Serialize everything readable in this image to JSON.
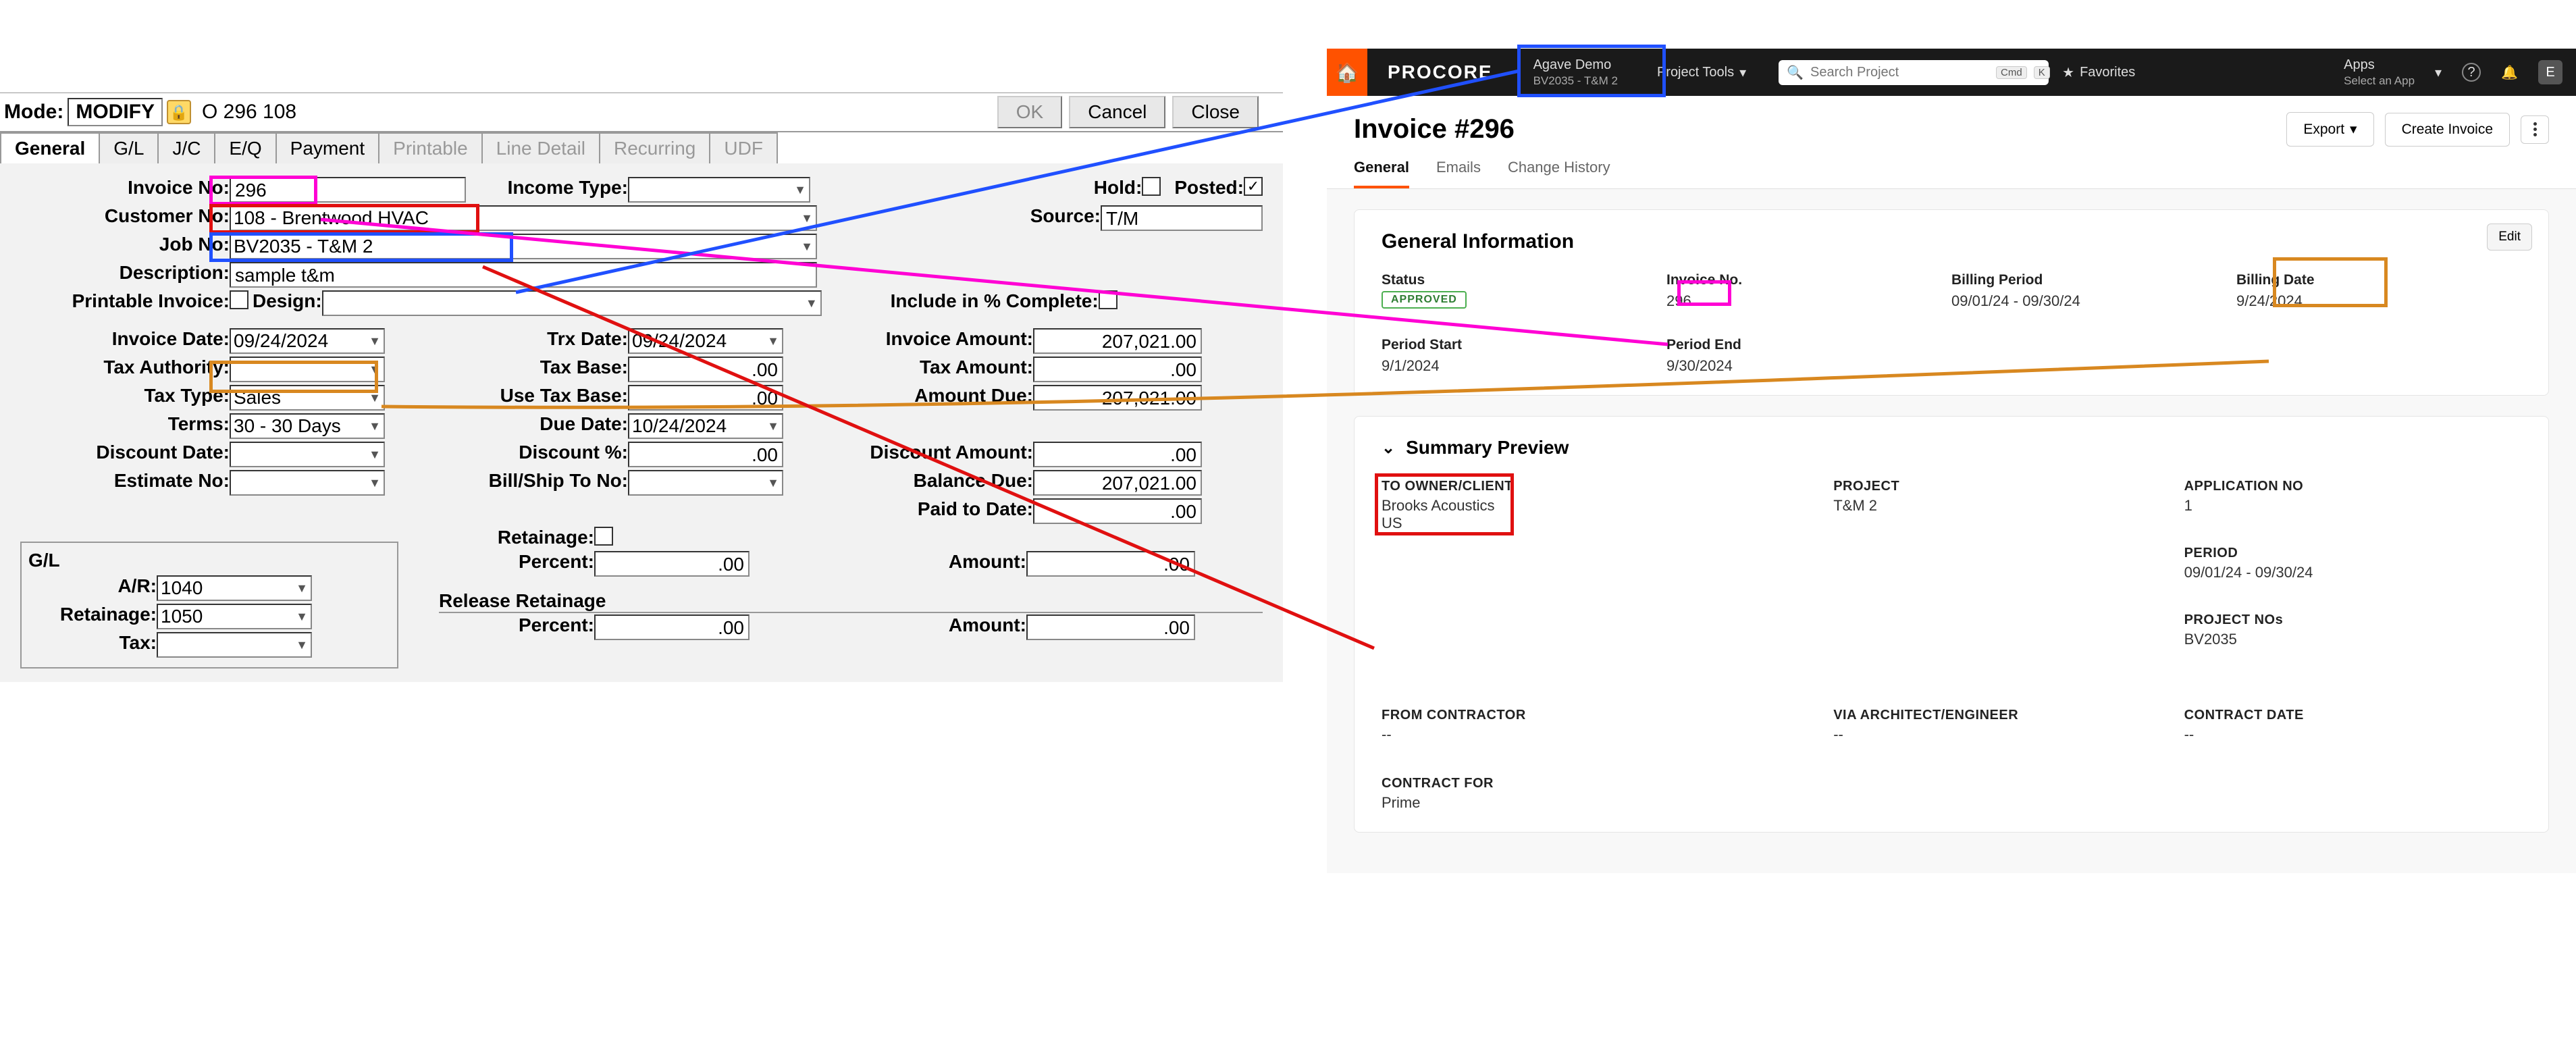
{
  "left": {
    "mode_label": "Mode:",
    "mode_value": "MODIFY",
    "lock_glyph": "🔒",
    "mode_info": "O  296  108",
    "btn_ok": "OK",
    "btn_cancel": "Cancel",
    "btn_close": "Close",
    "tabs": {
      "general": "General",
      "gl": "G/L",
      "jc": "J/C",
      "eq": "E/Q",
      "payment": "Payment",
      "printable": "Printable",
      "line_detail": "Line Detail",
      "recurring": "Recurring",
      "udf": "UDF"
    },
    "labels": {
      "invoice_no": "Invoice No:",
      "income_type": "Income Type:",
      "hold": "Hold:",
      "posted": "Posted:",
      "customer_no": "Customer No:",
      "source": "Source:",
      "job_no": "Job No:",
      "description": "Description:",
      "printable_invoice": "Printable Invoice:",
      "design": "Design:",
      "include_pct": "Include in % Complete:",
      "invoice_date": "Invoice Date:",
      "trx_date": "Trx Date:",
      "invoice_amount": "Invoice Amount:",
      "tax_authority": "Tax Authority:",
      "tax_base": "Tax Base:",
      "tax_amount": "Tax Amount:",
      "tax_type": "Tax Type:",
      "use_tax_base": "Use Tax Base:",
      "amount_due": "Amount Due:",
      "terms": "Terms:",
      "due_date": "Due Date:",
      "discount_date": "Discount Date:",
      "discount_pct": "Discount %:",
      "discount_amount": "Discount Amount:",
      "estimate_no": "Estimate No:",
      "bill_ship_to": "Bill/Ship To No:",
      "balance_due": "Balance Due:",
      "paid_to_date": "Paid to Date:",
      "retainage": "Retainage:",
      "percent": "Percent:",
      "amount": "Amount:",
      "release_retainage": "Release Retainage",
      "gl": "G/L",
      "ar": "A/R:",
      "retainage_acct": "Retainage:",
      "tax": "Tax:"
    },
    "values": {
      "invoice_no": "296",
      "customer_no": "108  - Brentwood HVAC",
      "job_no": "BV2035  - T&M 2",
      "description": "sample t&m",
      "source": "T/M",
      "posted_check": "✓",
      "invoice_date": "09/24/2024",
      "trx_date": "09/24/2024",
      "invoice_amount": "207,021.00",
      "tax_base": ".00",
      "tax_amount": ".00",
      "tax_type": "Sales",
      "use_tax_base": ".00",
      "amount_due": "207,021.00",
      "terms": "30  - 30 Days",
      "due_date": "10/24/2024",
      "discount_pct": ".00",
      "discount_amount": ".00",
      "balance_due": "207,021.00",
      "paid_to_date": ".00",
      "ret_percent": ".00",
      "ret_amount": ".00",
      "rel_percent": ".00",
      "rel_amount": ".00",
      "ar_acct": "1040",
      "retainage_acct": "1050"
    }
  },
  "right": {
    "top": {
      "logo": "PROCORE",
      "proj_name": "Agave Demo",
      "proj_sub": "BV2035 - T&M 2",
      "tools": "Project Tools",
      "search_ph": "Search Project",
      "cmd": "Cmd",
      "k": "K",
      "fav_glyph": "★",
      "favorites": "Favorites",
      "apps": "Apps",
      "apps_sub": "Select an App",
      "help": "?",
      "bell": "🔔",
      "avatar": "E"
    },
    "header": {
      "title": "Invoice #296",
      "export": "Export",
      "create": "Create Invoice"
    },
    "page_tabs": {
      "general": "General",
      "emails": "Emails",
      "change_history": "Change History"
    },
    "general_info": {
      "title": "General Information",
      "edit": "Edit",
      "status_lbl": "Status",
      "status_val": "APPROVED",
      "invno_lbl": "Invoice No.",
      "invno_val": "296",
      "bp_lbl": "Billing Period",
      "bp_val": "09/01/24 - 09/30/24",
      "bd_lbl": "Billing Date",
      "bd_val": "9/24/2024",
      "ps_lbl": "Period Start",
      "ps_val": "9/1/2024",
      "pe_lbl": "Period End",
      "pe_val": "9/30/2024"
    },
    "summary": {
      "title": "Summary Preview",
      "to_owner_lbl": "TO OWNER/CLIENT",
      "to_owner_val1": "Brooks Acoustics",
      "to_owner_val2": "US",
      "project_lbl": "PROJECT",
      "project_val": "T&M 2",
      "appno_lbl": "APPLICATION NO",
      "appno_val": "1",
      "period_lbl": "PERIOD",
      "period_val": "09/01/24 - 09/30/24",
      "projnos_lbl": "PROJECT NOs",
      "projnos_val": "BV2035",
      "from_lbl": "FROM CONTRACTOR",
      "from_val": "--",
      "via_lbl": "VIA ARCHITECT/ENGINEER",
      "via_val": "--",
      "cdate_lbl": "CONTRACT DATE",
      "cdate_val": "--",
      "cfor_lbl": "CONTRACT FOR",
      "cfor_val": "Prime"
    }
  }
}
